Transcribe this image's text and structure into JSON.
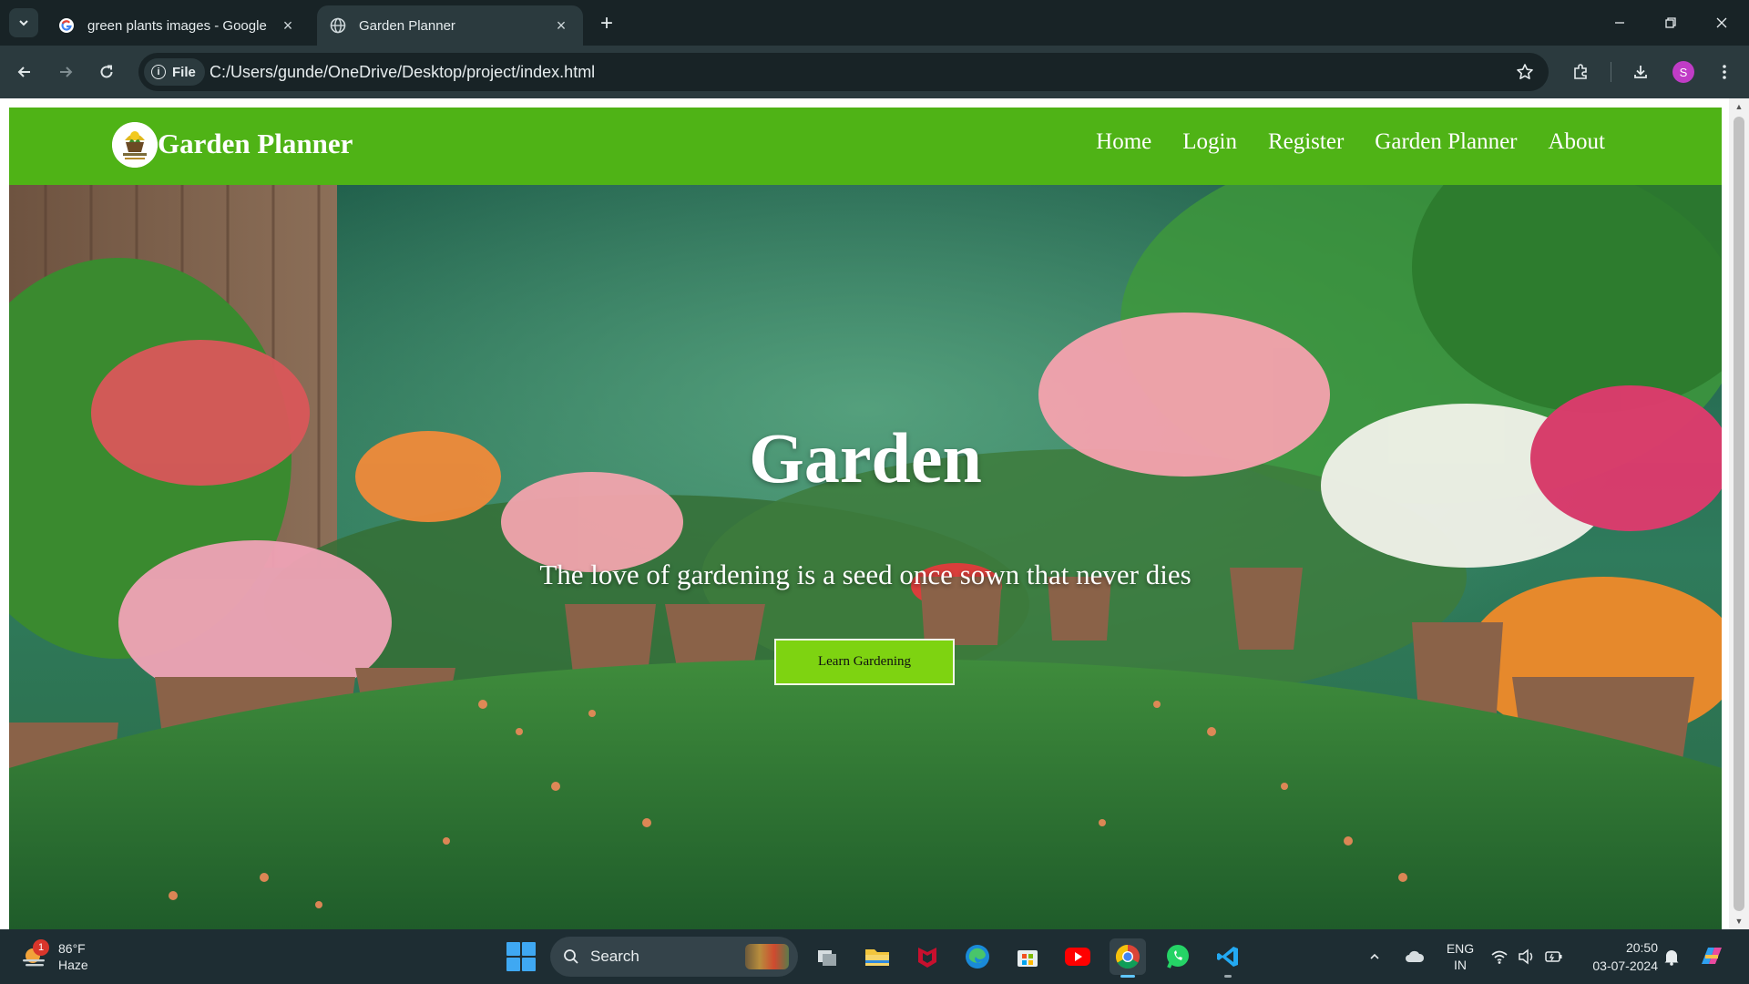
{
  "browser": {
    "tabs": [
      {
        "title": "green plants images - Google S",
        "active": false
      },
      {
        "title": "Garden Planner",
        "active": true
      }
    ],
    "address": {
      "scheme_chip": "File",
      "url": "C:/Users/gunde/OneDrive/Desktop/project/index.html"
    },
    "profile_initial": "S"
  },
  "site": {
    "title": "Garden Planner",
    "nav": [
      "Home",
      "Login",
      "Register",
      "Garden Planner",
      "About"
    ],
    "hero": {
      "title": "Garden",
      "quote": "The love of gardening is a seed once sown that never dies",
      "button": "Learn Gardening"
    },
    "colors": {
      "header_green": "#4fb316",
      "button_green": "#7ed311"
    }
  },
  "taskbar": {
    "weather": {
      "temperature": "86°F",
      "condition": "Haze",
      "badge": "1"
    },
    "search_label": "Search",
    "apps": [
      "task-view-icon",
      "file-explorer-icon",
      "mcafee-icon",
      "edge-icon",
      "microsoft-store-icon",
      "youtube-icon",
      "chrome-icon",
      "whatsapp-icon",
      "vscode-icon"
    ],
    "language": {
      "line1": "ENG",
      "line2": "IN"
    },
    "clock": {
      "time": "20:50",
      "date": "03-07-2024"
    }
  }
}
